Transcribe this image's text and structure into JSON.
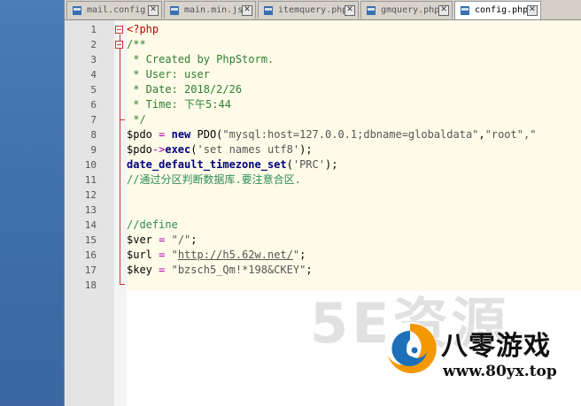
{
  "tabs": [
    {
      "label": "mail.config",
      "active": false
    },
    {
      "label": "main.min.js",
      "active": false
    },
    {
      "label": "itemquery.php",
      "active": false
    },
    {
      "label": "gmquery.php",
      "active": false
    },
    {
      "label": "config.php",
      "active": true
    }
  ],
  "line_numbers": [
    "1",
    "2",
    "3",
    "4",
    "5",
    "6",
    "7",
    "8",
    "9",
    "10",
    "11",
    "12",
    "13",
    "14",
    "15",
    "16",
    "17",
    "18"
  ],
  "code": {
    "l1": "<?php",
    "l2": "/**",
    "l3": " * Created by PhpStorm.",
    "l4": " * User: user",
    "l5": " * Date: 2018/2/26",
    "l6": " * Time: 下午5:44",
    "l7": " */",
    "l8_var": "$pdo",
    "l8_eq": " = ",
    "l8_new": "new",
    "l8_cls": " PDO(",
    "l8_s1": "\"mysql:host=127.0.0.1;dbname=globaldata\"",
    "l8_c": ",",
    "l8_s2": "\"root\"",
    "l8_tail": ",\"",
    "l9_var": "$pdo",
    "l9_arrow": "->",
    "l9_fn": "exec",
    "l9_p": "(",
    "l9_s": "'set names utf8'",
    "l9_end": ");",
    "l10_fn": "date_default_timezone_set",
    "l10_p": "(",
    "l10_s": "'PRC'",
    "l10_end": ");",
    "l11": "//通过分区判断数据库.要注意合区.",
    "l14": "//define",
    "l15_var": "$ver",
    "l15_eq": " = ",
    "l15_s": "\"/\"",
    "l15_end": ";",
    "l16_var": "$url",
    "l16_eq": " = ",
    "l16_q1": "\"",
    "l16_link": "http://h5.62w.net/",
    "l16_q2": "\"",
    "l16_end": ";",
    "l17_var": "$key",
    "l17_eq": " = ",
    "l17_s": "\"bzsch5_Qm!*198&CKEY\"",
    "l17_end": ";"
  },
  "watermark": {
    "faint_text": "5E资源",
    "name": "八零游戏",
    "url": "www.80yx.top"
  },
  "colors": {
    "comment": "#2e8b57",
    "keyword": "#000080",
    "fold_marker": "#cc3333",
    "highlight": "#fefce8",
    "logo_orange": "#f39800",
    "logo_blue": "#1d6fb8"
  }
}
